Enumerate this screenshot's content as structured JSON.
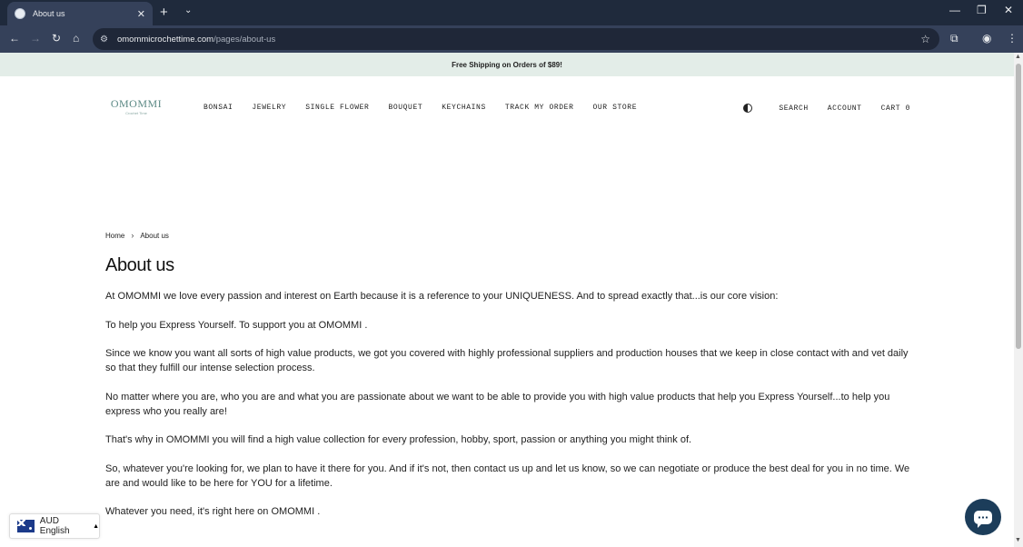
{
  "browser": {
    "tab_title": "About us",
    "url_domain": "omommicrochettime.com",
    "url_path": "/pages/about-us"
  },
  "announcement": "Free Shipping on Orders of $89!",
  "logo": {
    "text": "OMOMMI",
    "subtext": "Crochet Time"
  },
  "nav": {
    "items": [
      "BONSAI",
      "JEWELRY",
      "SINGLE FLOWER",
      "BOUQUET",
      "KEYCHAINS",
      "TRACK MY ORDER",
      "OUR STORE"
    ]
  },
  "header_right": {
    "search": "SEARCH",
    "account": "ACCOUNT",
    "cart": "CART 0"
  },
  "breadcrumb": {
    "home": "Home",
    "current": "About us"
  },
  "page_title": "About us",
  "paragraphs": [
    "At OMOMMI  we love every passion and interest on Earth because it is a reference to your UNIQUENESS. And to spread exactly that...is our core vision:",
    "To help you Express Yourself. To support you at OMOMMI .",
    "Since we know you want all sorts of high value products, we got you covered with highly professional suppliers and production houses that we keep in close contact with and vet daily so that they fulfill our intense selection process.",
    "No matter where you are, who you are and what you are passionate about we want to be able to provide you with high value products that help you Express Yourself...to help you express who you really are!",
    "That's why in OMOMMI  you will find a high value collection for every profession, hobby, sport, passion or anything you might think of.",
    "So, whatever you're looking for, we plan to have it there for you. And if it's not, then contact us up and let us know, so we can negotiate or produce the best deal for you in no time. We are and would like to be here for YOU for a lifetime.",
    "Whatever you need, it's right here on OMOMMI ."
  ],
  "currency": {
    "label": "AUD English"
  },
  "icons": {
    "theme": "theme-toggle-icon",
    "chat": "chat-icon",
    "flag": "australia-flag-icon"
  },
  "colors": {
    "announcement_bg": "#e3ede8",
    "chat_bg": "#1c3d5a",
    "browser_frame": "#1f2a3c"
  }
}
